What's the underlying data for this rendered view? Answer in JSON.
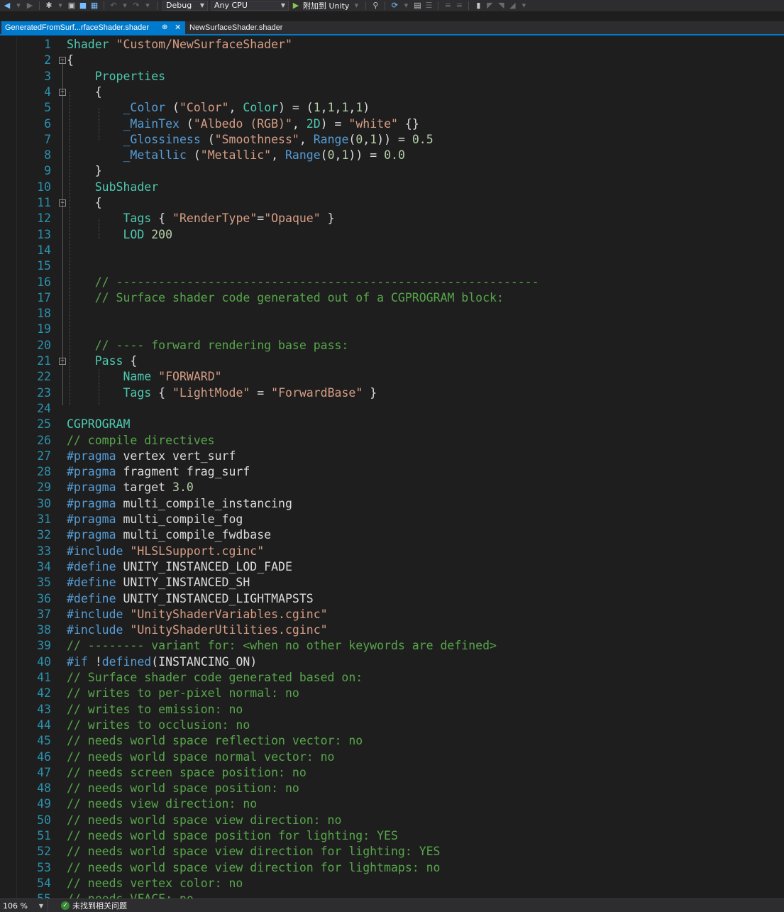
{
  "toolbar": {
    "config": "Debug",
    "platform": "Any CPU",
    "attach": "附加到 Unity"
  },
  "tabs": [
    {
      "label": "GeneratedFromSurf...rfaceShader.shader",
      "pin": "⊕",
      "close": "✕"
    },
    {
      "label": "NewSurfaceShader.shader"
    }
  ],
  "editor": {
    "lines": [
      {
        "n": "1",
        "fold": "",
        "tokens": [
          {
            "t": "Shader ",
            "c": "c-kw"
          },
          {
            "t": "\"Custom/NewSurfaceShader\"",
            "c": "c-str"
          }
        ]
      },
      {
        "n": "2",
        "fold": "⊟",
        "tokens": [
          {
            "t": "{",
            "c": "c-id"
          }
        ]
      },
      {
        "n": "3",
        "fold": "",
        "tokens": [
          {
            "t": "    ",
            "c": "c-id"
          },
          {
            "t": "Properties",
            "c": "c-kw"
          }
        ]
      },
      {
        "n": "4",
        "fold": "⊟",
        "tokens": [
          {
            "t": "    {",
            "c": "c-id"
          }
        ]
      },
      {
        "n": "5",
        "fold": "",
        "tokens": [
          {
            "t": "        ",
            "c": "c-id"
          },
          {
            "t": "_Color",
            "c": "c-pp"
          },
          {
            "t": " (",
            "c": "c-id"
          },
          {
            "t": "\"Color\"",
            "c": "c-str"
          },
          {
            "t": ", ",
            "c": "c-id"
          },
          {
            "t": "Color",
            "c": "c-kw"
          },
          {
            "t": ") = (",
            "c": "c-id"
          },
          {
            "t": "1",
            "c": "c-num"
          },
          {
            "t": ",",
            "c": "c-id"
          },
          {
            "t": "1",
            "c": "c-num"
          },
          {
            "t": ",",
            "c": "c-id"
          },
          {
            "t": "1",
            "c": "c-num"
          },
          {
            "t": ",",
            "c": "c-id"
          },
          {
            "t": "1",
            "c": "c-num"
          },
          {
            "t": ")",
            "c": "c-id"
          }
        ]
      },
      {
        "n": "6",
        "fold": "",
        "tokens": [
          {
            "t": "        ",
            "c": "c-id"
          },
          {
            "t": "_MainTex",
            "c": "c-pp"
          },
          {
            "t": " (",
            "c": "c-id"
          },
          {
            "t": "\"Albedo (RGB)\"",
            "c": "c-str"
          },
          {
            "t": ", ",
            "c": "c-id"
          },
          {
            "t": "2D",
            "c": "c-kw"
          },
          {
            "t": ") = ",
            "c": "c-id"
          },
          {
            "t": "\"white\"",
            "c": "c-str"
          },
          {
            "t": " {}",
            "c": "c-id"
          }
        ]
      },
      {
        "n": "7",
        "fold": "",
        "tokens": [
          {
            "t": "        ",
            "c": "c-id"
          },
          {
            "t": "_Glossiness",
            "c": "c-pp"
          },
          {
            "t": " (",
            "c": "c-id"
          },
          {
            "t": "\"Smoothness\"",
            "c": "c-str"
          },
          {
            "t": ", ",
            "c": "c-id"
          },
          {
            "t": "Range",
            "c": "c-pp"
          },
          {
            "t": "(",
            "c": "c-id"
          },
          {
            "t": "0",
            "c": "c-num"
          },
          {
            "t": ",",
            "c": "c-id"
          },
          {
            "t": "1",
            "c": "c-num"
          },
          {
            "t": ")) = ",
            "c": "c-id"
          },
          {
            "t": "0.5",
            "c": "c-num"
          }
        ]
      },
      {
        "n": "8",
        "fold": "",
        "tokens": [
          {
            "t": "        ",
            "c": "c-id"
          },
          {
            "t": "_Metallic",
            "c": "c-pp"
          },
          {
            "t": " (",
            "c": "c-id"
          },
          {
            "t": "\"Metallic\"",
            "c": "c-str"
          },
          {
            "t": ", ",
            "c": "c-id"
          },
          {
            "t": "Range",
            "c": "c-pp"
          },
          {
            "t": "(",
            "c": "c-id"
          },
          {
            "t": "0",
            "c": "c-num"
          },
          {
            "t": ",",
            "c": "c-id"
          },
          {
            "t": "1",
            "c": "c-num"
          },
          {
            "t": ")) = ",
            "c": "c-id"
          },
          {
            "t": "0.0",
            "c": "c-num"
          }
        ]
      },
      {
        "n": "9",
        "fold": "",
        "tokens": [
          {
            "t": "    }",
            "c": "c-id"
          }
        ]
      },
      {
        "n": "10",
        "fold": "",
        "tokens": [
          {
            "t": "    ",
            "c": "c-id"
          },
          {
            "t": "SubShader",
            "c": "c-kw"
          }
        ]
      },
      {
        "n": "11",
        "fold": "⊟",
        "tokens": [
          {
            "t": "    {",
            "c": "c-id"
          }
        ]
      },
      {
        "n": "12",
        "fold": "",
        "tokens": [
          {
            "t": "        ",
            "c": "c-id"
          },
          {
            "t": "Tags",
            "c": "c-kw"
          },
          {
            "t": " { ",
            "c": "c-id"
          },
          {
            "t": "\"RenderType\"",
            "c": "c-str"
          },
          {
            "t": "=",
            "c": "c-id"
          },
          {
            "t": "\"Opaque\"",
            "c": "c-str"
          },
          {
            "t": " }",
            "c": "c-id"
          }
        ]
      },
      {
        "n": "13",
        "fold": "",
        "tokens": [
          {
            "t": "        ",
            "c": "c-id"
          },
          {
            "t": "LOD",
            "c": "c-kw"
          },
          {
            "t": " ",
            "c": "c-id"
          },
          {
            "t": "200",
            "c": "c-num"
          }
        ]
      },
      {
        "n": "14",
        "fold": "",
        "tokens": []
      },
      {
        "n": "15",
        "fold": "",
        "tokens": []
      },
      {
        "n": "16",
        "fold": "",
        "tokens": [
          {
            "t": "    ",
            "c": "c-id"
          },
          {
            "t": "// ------------------------------------------------------------",
            "c": "c-com"
          }
        ]
      },
      {
        "n": "17",
        "fold": "",
        "tokens": [
          {
            "t": "    ",
            "c": "c-id"
          },
          {
            "t": "// Surface shader code generated out of a CGPROGRAM block:",
            "c": "c-com"
          }
        ]
      },
      {
        "n": "18",
        "fold": "",
        "tokens": []
      },
      {
        "n": "19",
        "fold": "",
        "tokens": []
      },
      {
        "n": "20",
        "fold": "",
        "tokens": [
          {
            "t": "    ",
            "c": "c-id"
          },
          {
            "t": "// ---- forward rendering base pass:",
            "c": "c-com"
          }
        ]
      },
      {
        "n": "21",
        "fold": "⊟",
        "tokens": [
          {
            "t": "    ",
            "c": "c-id"
          },
          {
            "t": "Pass",
            "c": "c-kw"
          },
          {
            "t": " {",
            "c": "c-id"
          }
        ]
      },
      {
        "n": "22",
        "fold": "",
        "tokens": [
          {
            "t": "        ",
            "c": "c-id"
          },
          {
            "t": "Name",
            "c": "c-kw"
          },
          {
            "t": " ",
            "c": "c-id"
          },
          {
            "t": "\"FORWARD\"",
            "c": "c-str"
          }
        ]
      },
      {
        "n": "23",
        "fold": "",
        "tokens": [
          {
            "t": "        ",
            "c": "c-id"
          },
          {
            "t": "Tags",
            "c": "c-kw"
          },
          {
            "t": " { ",
            "c": "c-id"
          },
          {
            "t": "\"LightMode\"",
            "c": "c-str"
          },
          {
            "t": " = ",
            "c": "c-id"
          },
          {
            "t": "\"ForwardBase\"",
            "c": "c-str"
          },
          {
            "t": " }",
            "c": "c-id"
          }
        ]
      },
      {
        "n": "24",
        "fold": "",
        "tokens": []
      },
      {
        "n": "25",
        "fold": "",
        "tokens": [
          {
            "t": "CGPROGRAM",
            "c": "c-kw"
          }
        ]
      },
      {
        "n": "26",
        "fold": "",
        "tokens": [
          {
            "t": "// compile directives",
            "c": "c-com"
          }
        ]
      },
      {
        "n": "27",
        "fold": "",
        "tokens": [
          {
            "t": "#pragma",
            "c": "c-pp"
          },
          {
            "t": " vertex vert_surf",
            "c": "c-id"
          }
        ]
      },
      {
        "n": "28",
        "fold": "",
        "tokens": [
          {
            "t": "#pragma",
            "c": "c-pp"
          },
          {
            "t": " fragment frag_surf",
            "c": "c-id"
          }
        ]
      },
      {
        "n": "29",
        "fold": "",
        "tokens": [
          {
            "t": "#pragma",
            "c": "c-pp"
          },
          {
            "t": " target ",
            "c": "c-id"
          },
          {
            "t": "3.0",
            "c": "c-num"
          }
        ]
      },
      {
        "n": "30",
        "fold": "",
        "tokens": [
          {
            "t": "#pragma",
            "c": "c-pp"
          },
          {
            "t": " multi_compile_instancing",
            "c": "c-id"
          }
        ]
      },
      {
        "n": "31",
        "fold": "",
        "tokens": [
          {
            "t": "#pragma",
            "c": "c-pp"
          },
          {
            "t": " multi_compile_fog",
            "c": "c-id"
          }
        ]
      },
      {
        "n": "32",
        "fold": "",
        "tokens": [
          {
            "t": "#pragma",
            "c": "c-pp"
          },
          {
            "t": " multi_compile_fwdbase",
            "c": "c-id"
          }
        ]
      },
      {
        "n": "33",
        "fold": "",
        "tokens": [
          {
            "t": "#include",
            "c": "c-pp"
          },
          {
            "t": " ",
            "c": "c-id"
          },
          {
            "t": "\"HLSLSupport.cginc\"",
            "c": "c-str"
          }
        ]
      },
      {
        "n": "34",
        "fold": "",
        "tokens": [
          {
            "t": "#define",
            "c": "c-pp"
          },
          {
            "t": " UNITY_INSTANCED_LOD_FADE",
            "c": "c-id"
          }
        ]
      },
      {
        "n": "35",
        "fold": "",
        "tokens": [
          {
            "t": "#define",
            "c": "c-pp"
          },
          {
            "t": " UNITY_INSTANCED_SH",
            "c": "c-id"
          }
        ]
      },
      {
        "n": "36",
        "fold": "",
        "tokens": [
          {
            "t": "#define",
            "c": "c-pp"
          },
          {
            "t": " UNITY_INSTANCED_LIGHTMAPSTS",
            "c": "c-id"
          }
        ]
      },
      {
        "n": "37",
        "fold": "",
        "tokens": [
          {
            "t": "#include",
            "c": "c-pp"
          },
          {
            "t": " ",
            "c": "c-id"
          },
          {
            "t": "\"UnityShaderVariables.cginc\"",
            "c": "c-str"
          }
        ]
      },
      {
        "n": "38",
        "fold": "",
        "tokens": [
          {
            "t": "#include",
            "c": "c-pp"
          },
          {
            "t": " ",
            "c": "c-id"
          },
          {
            "t": "\"UnityShaderUtilities.cginc\"",
            "c": "c-str"
          }
        ]
      },
      {
        "n": "39",
        "fold": "",
        "tokens": [
          {
            "t": "// -------- variant for: <when no other keywords are defined>",
            "c": "c-com"
          }
        ]
      },
      {
        "n": "40",
        "fold": "",
        "tokens": [
          {
            "t": "#if",
            "c": "c-pp"
          },
          {
            "t": " !",
            "c": "c-id"
          },
          {
            "t": "defined",
            "c": "c-pp"
          },
          {
            "t": "(INSTANCING_ON)",
            "c": "c-id"
          }
        ]
      },
      {
        "n": "41",
        "fold": "",
        "tokens": [
          {
            "t": "// Surface shader code generated based on:",
            "c": "c-com"
          }
        ]
      },
      {
        "n": "42",
        "fold": "",
        "tokens": [
          {
            "t": "// writes to per-pixel normal: no",
            "c": "c-com"
          }
        ]
      },
      {
        "n": "43",
        "fold": "",
        "tokens": [
          {
            "t": "// writes to emission: no",
            "c": "c-com"
          }
        ]
      },
      {
        "n": "44",
        "fold": "",
        "tokens": [
          {
            "t": "// writes to occlusion: no",
            "c": "c-com"
          }
        ]
      },
      {
        "n": "45",
        "fold": "",
        "tokens": [
          {
            "t": "// needs world space reflection vector: no",
            "c": "c-com"
          }
        ]
      },
      {
        "n": "46",
        "fold": "",
        "tokens": [
          {
            "t": "// needs world space normal vector: no",
            "c": "c-com"
          }
        ]
      },
      {
        "n": "47",
        "fold": "",
        "tokens": [
          {
            "t": "// needs screen space position: no",
            "c": "c-com"
          }
        ]
      },
      {
        "n": "48",
        "fold": "",
        "tokens": [
          {
            "t": "// needs world space position: no",
            "c": "c-com"
          }
        ]
      },
      {
        "n": "49",
        "fold": "",
        "tokens": [
          {
            "t": "// needs view direction: no",
            "c": "c-com"
          }
        ]
      },
      {
        "n": "50",
        "fold": "",
        "tokens": [
          {
            "t": "// needs world space view direction: no",
            "c": "c-com"
          }
        ]
      },
      {
        "n": "51",
        "fold": "",
        "tokens": [
          {
            "t": "// needs world space position for lighting: YES",
            "c": "c-com"
          }
        ]
      },
      {
        "n": "52",
        "fold": "",
        "tokens": [
          {
            "t": "// needs world space view direction for lighting: YES",
            "c": "c-com"
          }
        ]
      },
      {
        "n": "53",
        "fold": "",
        "tokens": [
          {
            "t": "// needs world space view direction for lightmaps: no",
            "c": "c-com"
          }
        ]
      },
      {
        "n": "54",
        "fold": "",
        "tokens": [
          {
            "t": "// needs vertex color: no",
            "c": "c-com"
          }
        ]
      },
      {
        "n": "55",
        "fold": "",
        "tokens": [
          {
            "t": "// needs VFACE: no",
            "c": "c-com"
          }
        ]
      }
    ]
  },
  "statusbar": {
    "zoom": "106 %",
    "issues": "未找到相关问题"
  }
}
